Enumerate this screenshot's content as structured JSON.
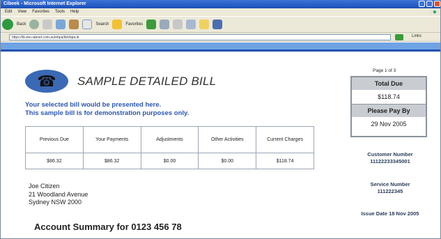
{
  "browser": {
    "title": "Cibeek - Microsoft Internet Explorer",
    "menu": [
      "Edit",
      "View",
      "Favorites",
      "Tools",
      "Help"
    ],
    "toolbar": {
      "back_label": "Back",
      "search_label": "Search",
      "favorites_label": "Favorites"
    },
    "address": "https://ib-ew.cabnet.com.au/ebpa/ib/ebpa.ib",
    "links_label": "Links"
  },
  "bill": {
    "heading": "SAMPLE DETAILED BILL",
    "intro_line1": "Your selected bill would be presented here.",
    "intro_line2": "This sample bill is for demonstration purposes only.",
    "charges": {
      "headers": [
        "Previous Due",
        "Your Payments",
        "Adjustments",
        "Other Activities",
        "Current Charges"
      ],
      "values": [
        "$86.32",
        "$86.32",
        "$0.00",
        "$0.00",
        "$118.74"
      ]
    },
    "address_lines": [
      "Joe Citizen",
      "21 Woodland Avenue",
      "Sydney NSW 2000"
    ],
    "account_summary": "Account Summary for 0123 456 78"
  },
  "sidebar": {
    "page_label": "Page 1 of 3",
    "total_due_label": "Total Due",
    "total_due_value": "$118.74",
    "pay_by_label": "Please Pay By",
    "pay_by_value": "29 Nov 2005",
    "customer_number_label": "Customer Number",
    "customer_number": "11122233345001",
    "service_number_label": "Service Number",
    "service_number": "111222345",
    "issue_date": "Issue Date 18 Nov 2005"
  },
  "colors": {
    "accent_blue": "#2c57b0",
    "title_bar": "#1a4fb8",
    "box_gray": "#c9cdd2"
  }
}
